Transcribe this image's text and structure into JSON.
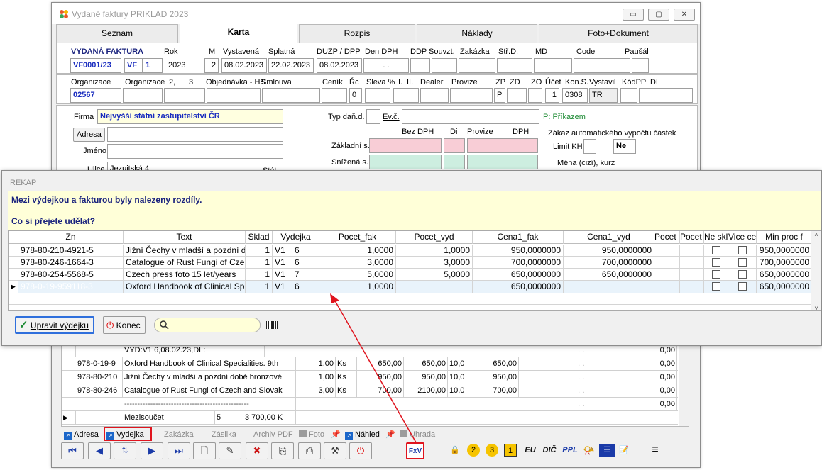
{
  "main_window": {
    "title": "Vydané faktury PRIKLAD  2023",
    "tabs": [
      "Seznam",
      "Karta",
      "Rozpis",
      "Náklady",
      "Foto+Dokument"
    ],
    "header": {
      "doc_type_label": "VYDANÁ FAKTURA",
      "rok_label": "Rok",
      "m_label": "M",
      "vystavena_label": "Vystavená",
      "splatna_label": "Splatná",
      "duzp_label": "DUZP / DPP",
      "den_dph_label": "Den DPH",
      "ddp_label": "DDP",
      "souvzt_label": "Souvzt.",
      "zakazka_label": "Zakázka",
      "strd_label": "Stř.D.",
      "md_label": "MD",
      "code_label": "Code",
      "pausal_label": "Paušál",
      "doc_number": "VF0001/23",
      "series": "VF",
      "series_num": "1",
      "year": "2023",
      "month": "2",
      "vystavena": "08.02.2023",
      "splatna": "22.02.2023",
      "duzp": "08.02.2023",
      "den_dph": ". ."
    },
    "org_row": {
      "organizace_label": "Organizace",
      "organizace2_label": "Organizace",
      "n2": "2,",
      "n3": "3",
      "objednavka_label": "Objednávka - HS",
      "smlouva_label": "Smlouva",
      "cenik_label": "Ceník",
      "rc_label": "Řc",
      "sleva_label": "Sleva %",
      "i_label": "I.",
      "ii_label": "II.",
      "dealer_label": "Dealer",
      "provize_label": "Provize",
      "zp_label": "ZP",
      "zd_label": "ZD",
      "zo_label": "ZO",
      "ucet_label": "Účet",
      "kons_label": "Kon.S.",
      "vystavil_label": "Vystavil",
      "kodpp_label": "KódPP",
      "dl_label": "DL",
      "organizace": "02567",
      "rc": "0",
      "zp": "P",
      "ucet": "1",
      "kons": "0308",
      "vystavil": "TR"
    },
    "firma": {
      "firma_label": "Firma",
      "firma_value": "Nejvyšší státní zastupitelství ČR",
      "adresa_button": "Adresa",
      "jmeno_label": "Jméno",
      "ulice_label": "Ulice",
      "ulice_value": "Jezuitská 4",
      "stat_label": "Stát"
    },
    "tax": {
      "typ_dan_label": "Typ daň.d.",
      "evc_label": "Ev.č.",
      "prikazem": "P: Příkazem",
      "bez_dph": "Bez DPH",
      "di": "Di",
      "provize": "Provize",
      "dph": "DPH",
      "zakladni": "Základní s.",
      "snizena": "Snížená s.",
      "zakaz_label": "Zákaz automatického výpočtu částek",
      "limit_kh": "Limit KH",
      "ne": "Ne",
      "mena_label": "Měna (cizí), kurz"
    },
    "items": {
      "header_line": "VYD:V1   6,08.02.23,DL:",
      "header_dots": ". .",
      "header_zero": "0,00",
      "rows": [
        {
          "code": "978-0-19-9",
          "name": "Oxford Handbook of Clinical Specialities. 9th",
          "qty": "1,00",
          "unit": "Ks",
          "price": "650,00",
          "total": "650,00",
          "vat": "10,0",
          "net": "650,00",
          "dots": ". .",
          "z": "0,00"
        },
        {
          "code": "978-80-210",
          "name": "Jižní Čechy v mladší a pozdní době bronzové",
          "qty": "1,00",
          "unit": "Ks",
          "price": "950,00",
          "total": "950,00",
          "vat": "10,0",
          "net": "950,00",
          "dots": ". .",
          "z": "0,00"
        },
        {
          "code": "978-80-246",
          "name": "Catalogue of Rust Fungi of Czech and Slovak",
          "qty": "3,00",
          "unit": "Ks",
          "price": "700,00",
          "total": "2100,00",
          "vat": "10,0",
          "net": "700,00",
          "dots": ". .",
          "z": "0,00"
        }
      ],
      "separator": "------------------------------------------------",
      "subtotal_label": "Mezisoučet",
      "subtotal_count": "5",
      "subtotal_value": "3 700,00 K",
      "extra_dots": ". .",
      "extra_zero": "0,00"
    },
    "bottom_links": [
      "Adresa",
      "Vydejka",
      "Zakázka",
      "Zásilka",
      "Archiv PDF",
      "Foto",
      "Náhled",
      "Úhrada"
    ],
    "toolbar_text": {
      "fxv": "FxV",
      "eu": "EU",
      "dic": "DIČ",
      "ppl": "PPL"
    }
  },
  "rekap": {
    "title": "REKAP",
    "message1": "Mezi výdejkou a fakturou byly nalezeny rozdíly.",
    "message2": "Co si přejete udělat?",
    "columns": [
      "Zn",
      "Text",
      "Sklad",
      "Vydejka",
      "Pocet_fak",
      "Pocet_vyd",
      "Cena1_fak",
      "Cena1_vyd",
      "Pocet",
      "Pocet",
      "Ne skl",
      "Vice ce",
      "Min proc f"
    ],
    "rows": [
      {
        "zn": "978-80-210-4921-5",
        "text": "Jižní Čechy v mladší a pozdní d",
        "sklad": "1",
        "vyd1": "V1",
        "vyd2": "6",
        "pocet_fak": "1,0000",
        "pocet_vyd": "1,0000",
        "cena_fak": "950,0000000",
        "cena_vyd": "950,0000000",
        "min": "950,0000000"
      },
      {
        "zn": "978-80-246-1664-3",
        "text": "Catalogue of Rust Fungi of Cze",
        "sklad": "1",
        "vyd1": "V1",
        "vyd2": "6",
        "pocet_fak": "3,0000",
        "pocet_vyd": "3,0000",
        "cena_fak": "700,0000000",
        "cena_vyd": "700,0000000",
        "min": "700,0000000"
      },
      {
        "zn": "978-80-254-5568-5",
        "text": "Czech press foto 15 let/years",
        "sklad": "1",
        "vyd1": "V1",
        "vyd2": "7",
        "pocet_fak": "5,0000",
        "pocet_vyd": "5,0000",
        "cena_fak": "650,0000000",
        "cena_vyd": "650,0000000",
        "min": "650,0000000"
      },
      {
        "zn": "978-0-19-959118-3",
        "text": "Oxford Handbook of Clinical Sp",
        "sklad": "1",
        "vyd1": "V1",
        "vyd2": "6",
        "pocet_fak": "1,0000",
        "pocet_vyd": "",
        "cena_fak": "650,0000000",
        "cena_vyd": "",
        "min": "650,0000000"
      }
    ],
    "btn_upravit": "Upravit výdejku",
    "btn_konec": "Konec",
    "search_value": ""
  },
  "colors": {
    "accent_blue": "#1a2dbf",
    "selection": "#0f6fc6",
    "diff_highlight": "#f9c8b8",
    "message_bg": "#ffffd8",
    "annotation_red": "#e0141e"
  }
}
